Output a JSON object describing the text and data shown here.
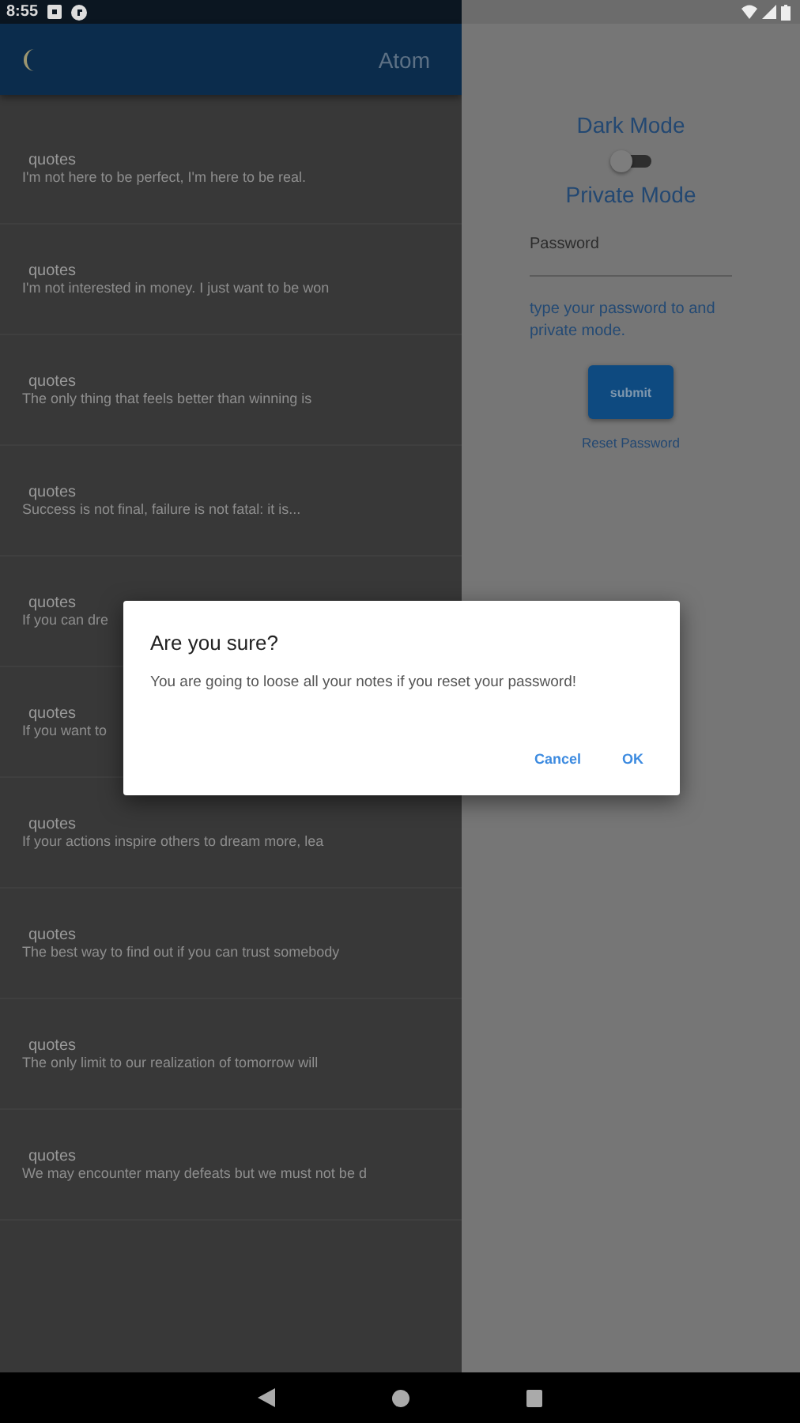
{
  "status_bar": {
    "time": "8:55"
  },
  "app_bar": {
    "title": "Atom"
  },
  "notes": [
    {
      "title": "quotes",
      "text": "I'm not here to be perfect, I'm here to be real."
    },
    {
      "title": "quotes",
      "text": "I'm not interested in money. I just want to be won"
    },
    {
      "title": "quotes",
      "text": "The only thing that feels better than winning is"
    },
    {
      "title": "quotes",
      "text": "Success is not final, failure is not fatal: it is..."
    },
    {
      "title": "quotes",
      "text": "If you can dre"
    },
    {
      "title": "quotes",
      "text": "If you want to"
    },
    {
      "title": "quotes",
      "text": "If your actions inspire others to dream more, lea"
    },
    {
      "title": "quotes",
      "text": "The best way to find out if you can trust somebody"
    },
    {
      "title": "quotes",
      "text": "The only limit to our realization of tomorrow will"
    },
    {
      "title": "quotes",
      "text": "We may encounter many defeats but we must not be d"
    }
  ],
  "drawer": {
    "dark_mode": {
      "label": "Dark Mode",
      "on": false
    },
    "private_mode_label": "Private Mode",
    "password": {
      "placeholder": "Password"
    },
    "hint": "type your password to and private mode.",
    "submit": "submit",
    "reset": "Reset Password"
  },
  "dialog": {
    "title": "Are you sure?",
    "message": "You are going to loose all your notes if you reset your password!",
    "buttons": [
      "Cancel",
      "OK"
    ]
  }
}
